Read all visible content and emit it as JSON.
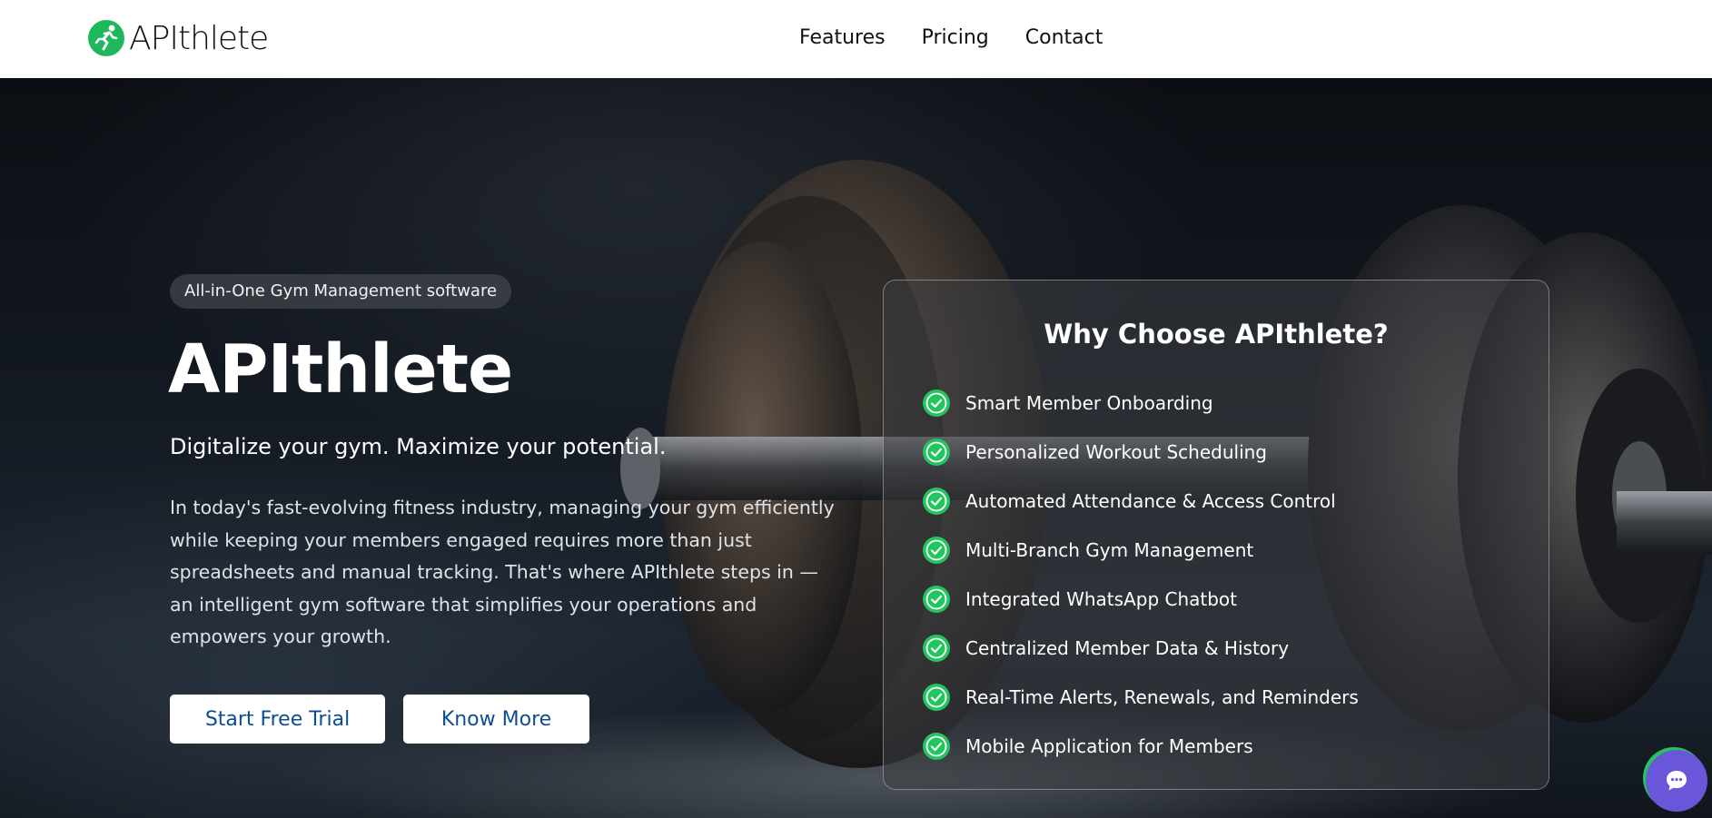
{
  "header": {
    "brand": "APIthlete",
    "nav": [
      "Features",
      "Pricing",
      "Contact"
    ]
  },
  "hero": {
    "badge": "All-in-One Gym Management software",
    "title": "APIthlete",
    "tagline": "Digitalize your gym. Maximize your potential.",
    "description": "In today's fast-evolving fitness industry, managing your gym efficiently while keeping your members engaged requires more than just spreadsheets and manual tracking. That's where APIthlete steps in — an intelligent gym software that simplifies your operations and empowers your growth.",
    "buttons": {
      "primary": "Start Free Trial",
      "secondary": "Know More"
    }
  },
  "card": {
    "title": "Why Choose APIthlete?",
    "features": [
      "Smart Member Onboarding",
      "Personalized Workout Scheduling",
      "Automated Attendance & Access Control",
      "Multi-Branch Gym Management",
      "Integrated WhatsApp Chatbot",
      "Centralized Member Data & History",
      "Real-Time Alerts, Renewals, and Reminders",
      "Mobile Application for Members"
    ]
  },
  "icons": {
    "brand": "running-person-icon",
    "feature": "check-circle-icon",
    "chat": "chat-bubble-icon"
  },
  "colors": {
    "accent_green": "#22c55e",
    "button_text": "#0e4c94",
    "chat_purple": "#6a56d8"
  }
}
